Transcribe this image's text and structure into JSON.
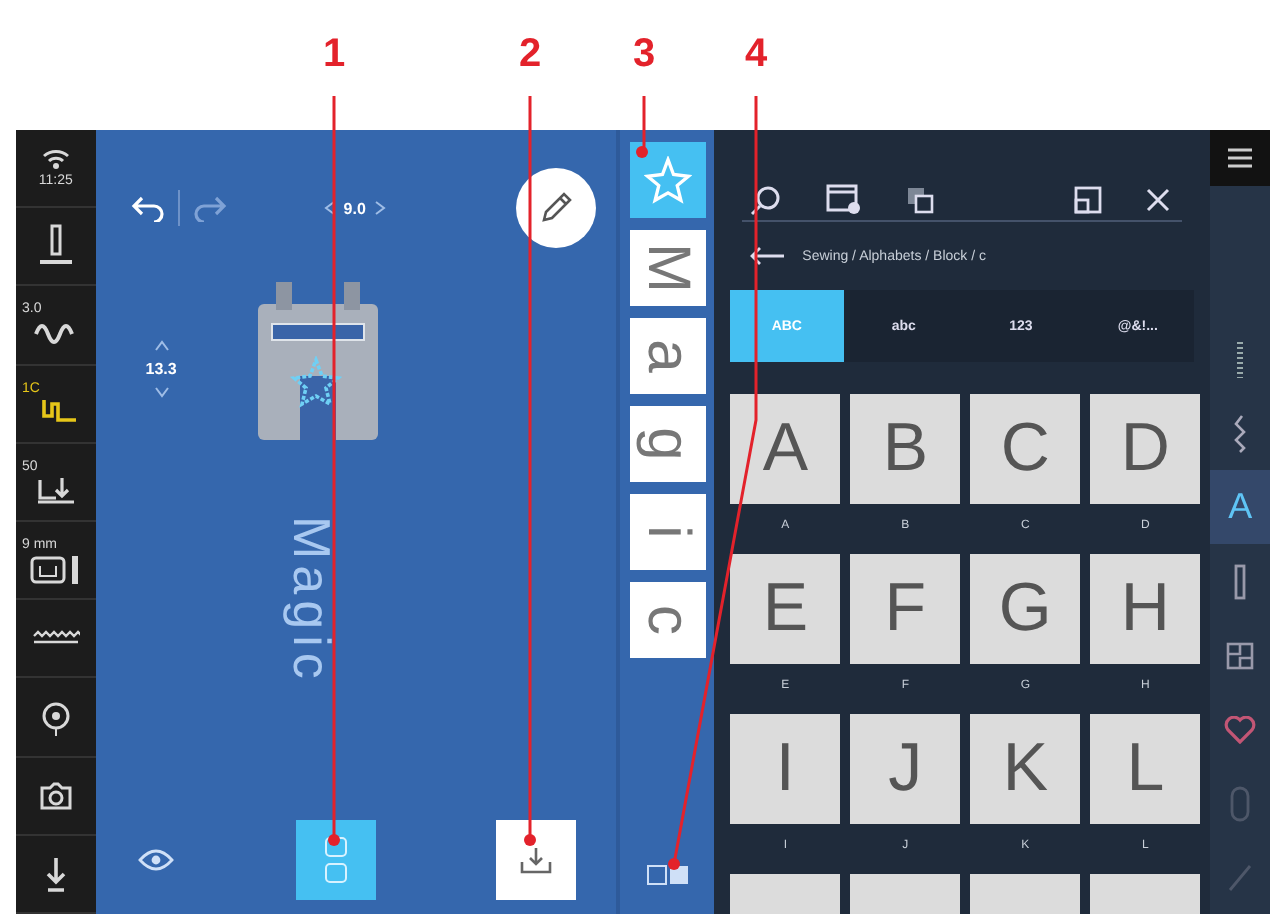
{
  "callouts": [
    {
      "label": "1"
    },
    {
      "label": "2"
    },
    {
      "label": "3"
    },
    {
      "label": "4"
    }
  ],
  "sidebar": {
    "items": [
      {
        "kind": "wifi",
        "label": "11:25",
        "highlighted": false
      },
      {
        "kind": "needle",
        "highlighted": false
      },
      {
        "kind": "stitch-length",
        "label": "3.0",
        "highlighted": false
      },
      {
        "kind": "presser-foot",
        "label": "1C",
        "highlighted": true
      },
      {
        "kind": "tension",
        "label": "50",
        "highlighted": false
      },
      {
        "kind": "stitch-width",
        "label": "9 mm",
        "highlighted": false
      },
      {
        "kind": "feed-dog",
        "highlighted": false
      },
      {
        "kind": "bobbin",
        "highlighted": false
      },
      {
        "kind": "camera",
        "highlighted": false
      },
      {
        "kind": "needle-stop",
        "highlighted": false
      }
    ]
  },
  "canvas": {
    "width_value": "9.0",
    "height_value": "13.3",
    "design_text": "Magic",
    "arrange_button": {
      "selected": true
    },
    "import_button": {
      "selected": false
    }
  },
  "stitch_list": [
    {
      "kind": "star",
      "selected": true
    },
    {
      "kind": "letter",
      "label": "M",
      "selected": false
    },
    {
      "kind": "letter",
      "label": "a",
      "selected": false
    },
    {
      "kind": "letter",
      "label": "g",
      "selected": false
    },
    {
      "kind": "letter",
      "label": "i",
      "selected": false
    },
    {
      "kind": "letter",
      "label": "c",
      "selected": false
    }
  ],
  "panel": {
    "breadcrumb": "Sewing / Alphabets / Block / c",
    "tabs": [
      {
        "label": "ABC",
        "selected": true
      },
      {
        "label": "abc",
        "selected": false
      },
      {
        "label": "123",
        "selected": false
      },
      {
        "label": "@&!...",
        "selected": false
      }
    ],
    "letters": [
      {
        "glyph": "A",
        "label": "A"
      },
      {
        "glyph": "B",
        "label": "B"
      },
      {
        "glyph": "C",
        "label": "C"
      },
      {
        "glyph": "D",
        "label": "D"
      },
      {
        "glyph": "E",
        "label": "E"
      },
      {
        "glyph": "F",
        "label": "F"
      },
      {
        "glyph": "G",
        "label": "G"
      },
      {
        "glyph": "H",
        "label": "H"
      },
      {
        "glyph": "I",
        "label": "I"
      },
      {
        "glyph": "J",
        "label": "J"
      },
      {
        "glyph": "K",
        "label": "K"
      },
      {
        "glyph": "L",
        "label": "L"
      }
    ]
  },
  "right_rail": [
    {
      "kind": "dotted",
      "selected": false,
      "disabled": false
    },
    {
      "kind": "zigzag",
      "selected": false,
      "disabled": false
    },
    {
      "kind": "alphabet",
      "label": "A",
      "selected": true,
      "disabled": false
    },
    {
      "kind": "bar",
      "selected": false,
      "disabled": false
    },
    {
      "kind": "quilt",
      "selected": false,
      "disabled": false
    },
    {
      "kind": "heart",
      "selected": false,
      "disabled": false
    },
    {
      "kind": "bobbin",
      "selected": false,
      "disabled": true
    },
    {
      "kind": "pencil",
      "selected": false,
      "disabled": true
    }
  ]
}
